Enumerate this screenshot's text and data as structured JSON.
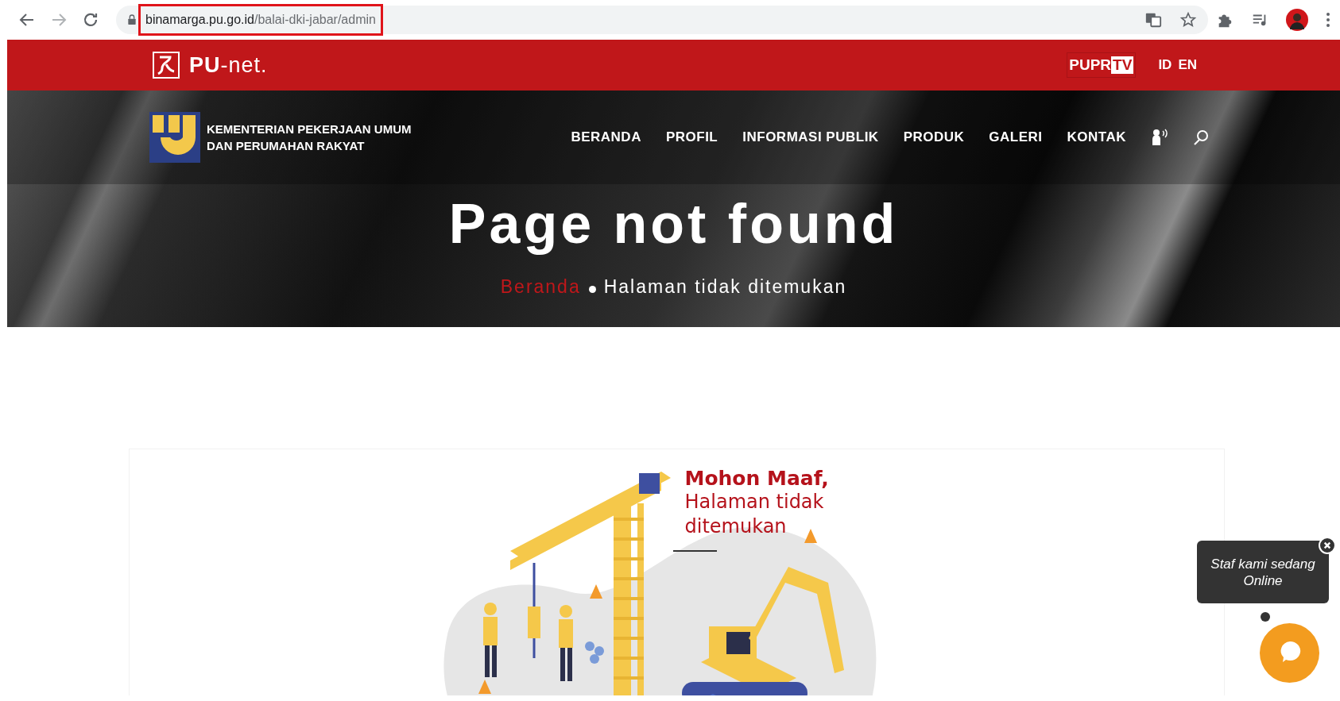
{
  "browser": {
    "url_host": "binamarga.pu.go.id",
    "url_path": "/balai-dki-jabar/admin",
    "url_highlighted": true
  },
  "topbar": {
    "logo_text": "**PU**-net.",
    "tv_badge": [
      "PUPR",
      "TV"
    ],
    "languages": [
      "ID",
      "EN"
    ]
  },
  "header": {
    "ministry_lines": [
      "KEMENTERIAN PEKERJAAN UMUM",
      "DAN PERUMAHAN RAKYAT"
    ],
    "nav": [
      "BERANDA",
      "PROFIL",
      "INFORMASI PUBLIK",
      "PRODUK",
      "GALERI",
      "KONTAK"
    ]
  },
  "hero": {
    "title": "Page not found",
    "breadcrumb": [
      {
        "label": "Beranda",
        "kind": "link"
      },
      {
        "label": "Halaman tidak ditemukan",
        "kind": "current"
      }
    ]
  },
  "error_card": {
    "heading": "Mohon Maaf,",
    "message": "Halaman tidak ditemukan"
  },
  "chat": {
    "tooltip": "Staf kami sedang Online"
  }
}
